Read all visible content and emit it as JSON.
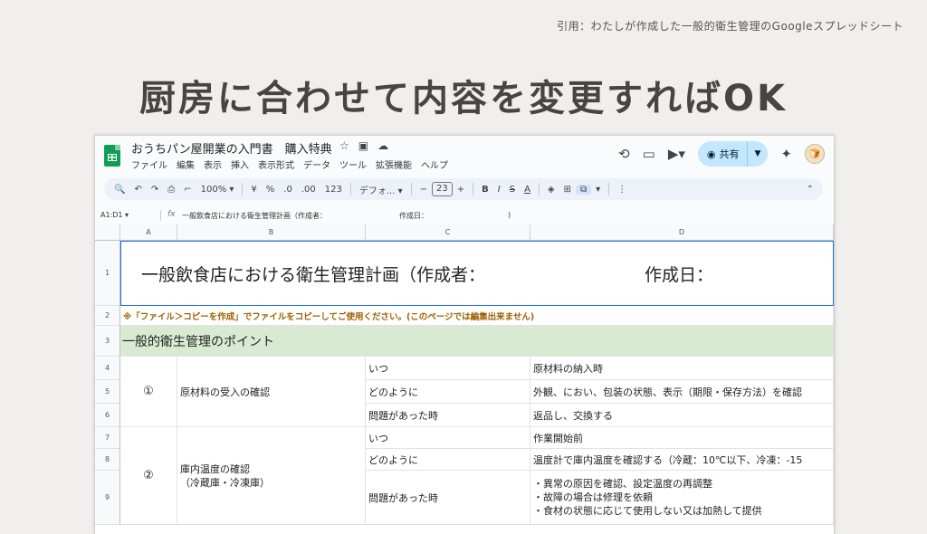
{
  "citation": "引用：わたしが作成した一般的衛生管理のGoogleスプレッドシート",
  "headline": "厨房に合わせて内容を変更すればOK",
  "window": {
    "doc_title": "おうちパン屋開業の入門書　購入特典",
    "title_icons": [
      "☆",
      "▣",
      "☁"
    ],
    "menu": [
      "ファイル",
      "編集",
      "表示",
      "挿入",
      "表示形式",
      "データ",
      "ツール",
      "拡張機能",
      "ヘルプ"
    ],
    "share_label": "共有"
  },
  "toolbar": {
    "zoom": "100%",
    "percent": "%",
    "decrease_decimal": ".0",
    "increase_decimal": ".00",
    "number_format": "123",
    "font": "デフォ...",
    "font_size": "23",
    "bold": "B",
    "italic": "I",
    "strike": "S",
    "text_color": "A"
  },
  "formula_bar": {
    "name_box": "A1:D1",
    "fx": "fx",
    "content_part1": "一般飲食店における衛生管理計画（作成者：",
    "content_part2": "作成日：",
    "content_part3": ")"
  },
  "columns": [
    "A",
    "B",
    "C",
    "D"
  ],
  "rows": [
    "1",
    "2",
    "3",
    "4",
    "5",
    "6",
    "7",
    "8",
    "9"
  ],
  "sheet": {
    "title_main": "一般飲食店における衛生管理計画（作成者：",
    "title_date": "作成日：",
    "note": "※「ファイル＞コピーを作成」でファイルをコピーしてご使用ください。(このページでは編集出来ません)",
    "section": "一般的衛生管理のポイント",
    "item1": {
      "num": "①",
      "name": "原材料の受入の確認",
      "when_label": "いつ",
      "when": "原材料の納入時",
      "how_label": "どのように",
      "how": "外観、におい、包装の状態、表示（期限・保存方法）を確認",
      "problem_label": "問題があった時",
      "problem": "返品し、交換する"
    },
    "item2": {
      "num": "②",
      "name_line1": "庫内温度の確認",
      "name_line2": "（冷蔵庫・冷凍庫）",
      "when_label": "いつ",
      "when": "作業開始前",
      "how_label": "どのように",
      "how": "温度計で庫内温度を確認する（冷蔵：10℃以下、冷凍：-15",
      "problem_label": "問題があった時",
      "problem_line1": "・異常の原因を確認、設定温度の再調整",
      "problem_line2": "・故障の場合は修理を依頼",
      "problem_line3": "・食材の状態に応じて使用しない又は加熱して提供"
    }
  }
}
